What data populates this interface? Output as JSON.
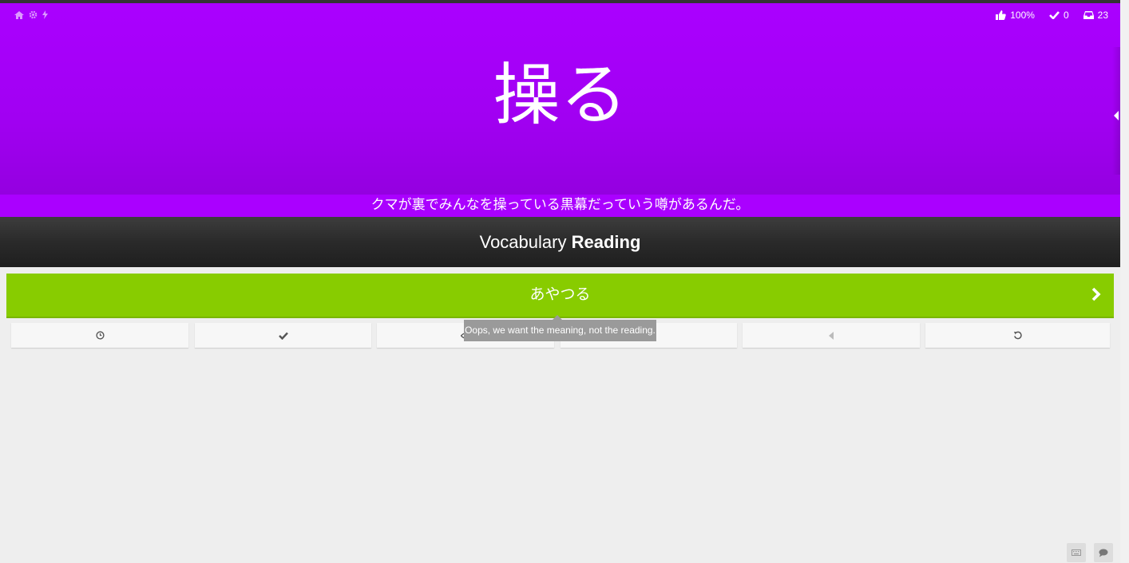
{
  "header": {
    "character": "操る",
    "stats": {
      "percent": "100%",
      "completed": "0",
      "remaining": "23"
    },
    "icons": [
      "home-icon",
      "settings-icon",
      "lightning-icon"
    ]
  },
  "sentence": "クマが裏でみんなを操っている黒幕だっていう噂があるんだ。",
  "quiz": {
    "type": "Vocabulary",
    "category": "Reading"
  },
  "answer": {
    "value": "あやつる"
  },
  "tooltip": "Oops, we want the meaning, not the reading.",
  "actions": [
    "clock-icon",
    "check-icon",
    "eye-icon",
    "info-icon",
    "audio-icon",
    "undo-icon"
  ],
  "colors": {
    "header": "#aa00ff",
    "correct": "#88cc00",
    "quiz_bar": "#2a2a2a"
  }
}
